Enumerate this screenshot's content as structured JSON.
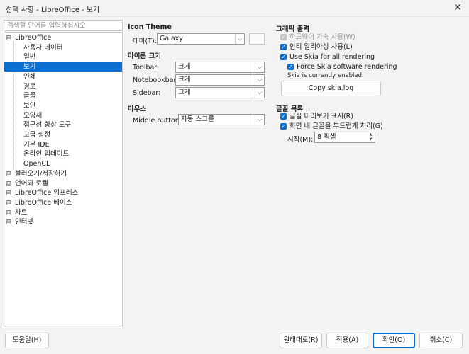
{
  "window": {
    "title": "선택 사항 - LibreOffice - 보기",
    "close_glyph": "✕"
  },
  "search": {
    "placeholder": "검색할 단어를 입력하십시오"
  },
  "tree": {
    "items": [
      {
        "label": "LibreOffice",
        "expander": "⊟"
      },
      {
        "label": "사용자 데이터"
      },
      {
        "label": "일반"
      },
      {
        "label": "보기"
      },
      {
        "label": "인쇄"
      },
      {
        "label": "경로"
      },
      {
        "label": "글꼴"
      },
      {
        "label": "보안"
      },
      {
        "label": "모양새"
      },
      {
        "label": "접근성 향상 도구"
      },
      {
        "label": "고급 설정"
      },
      {
        "label": "기본 IDE"
      },
      {
        "label": "온라인 업데이트"
      },
      {
        "label": "OpenCL"
      },
      {
        "label": "불러오기/저장하기",
        "expander": "⊞"
      },
      {
        "label": "언어와 로캘",
        "expander": "⊞"
      },
      {
        "label": "LibreOffice 임프레스",
        "expander": "⊞"
      },
      {
        "label": "LibreOffice 베이스",
        "expander": "⊞"
      },
      {
        "label": "차트",
        "expander": "⊞"
      },
      {
        "label": "인터넷",
        "expander": "⊞"
      }
    ],
    "selected_index": 3
  },
  "icon_theme": {
    "heading": "Icon Theme",
    "theme_label": "테마(T):",
    "theme_value": "Galaxy"
  },
  "icon_size": {
    "heading": "아이콘 크기",
    "toolbar_label": "Toolbar:",
    "toolbar_value": "크게",
    "notebookbar_label": "Notebookbar:",
    "notebookbar_value": "크게",
    "sidebar_label": "Sidebar:",
    "sidebar_value": "크게"
  },
  "mouse": {
    "heading": "마우스",
    "middle_label": "Middle button:",
    "middle_value": "자동 스크롤"
  },
  "graphics": {
    "heading": "그래픽 출력",
    "hw_accel": "하드웨어 가속 사용(W)",
    "antialias": "안티 알리아싱 사용(L)",
    "skia_all": "Use Skia for all rendering",
    "skia_software": "Force Skia software rendering",
    "skia_status": "Skia is currently enabled.",
    "copy_log": "Copy skia.log"
  },
  "font_list": {
    "heading": "글꼴 목록",
    "preview": "글꼴 미리보기 표시(R)",
    "smooth": "화면 내 글꼴을 부드럽게 처리(G)",
    "from_label": "시작(M):",
    "from_value": "8 픽셀"
  },
  "buttons": {
    "help": "도움말(H)",
    "reset": "원래대로(R)",
    "apply": "적용(A)",
    "ok": "확인(O)",
    "cancel": "취소(C)"
  },
  "glyphs": {
    "check": "✓",
    "dropdown": "⌵",
    "spin_up": "▲",
    "spin_down": "▼"
  },
  "colors": {
    "accent": "#0b6fd0",
    "disabled": "#9a9a9a"
  }
}
